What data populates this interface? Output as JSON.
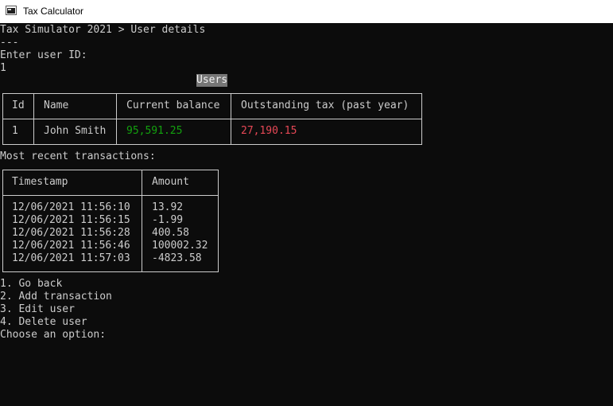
{
  "window": {
    "title": "Tax Calculator"
  },
  "breadcrumb": "Tax Simulator 2021 > User details",
  "separator": "---",
  "prompt_user_id": "Enter user ID:",
  "input_user_id": "1",
  "users_table": {
    "title": "Users",
    "headers": [
      "Id",
      "Name",
      "Current balance",
      "Outstanding tax (past year)"
    ],
    "row": [
      "1",
      "John Smith",
      "95,591.25",
      "27,190.15"
    ]
  },
  "transactions_label": "Most recent transactions:",
  "transactions_table": {
    "headers": [
      "Timestamp",
      "Amount"
    ],
    "rows": [
      [
        "12/06/2021 11:56:10",
        "13.92"
      ],
      [
        "12/06/2021 11:56:15",
        "-1.99"
      ],
      [
        "12/06/2021 11:56:28",
        "400.58"
      ],
      [
        "12/06/2021 11:56:46",
        "100002.32"
      ],
      [
        "12/06/2021 11:57:03",
        "-4823.58"
      ]
    ]
  },
  "menu": [
    "1. Go back",
    "2. Add transaction",
    "3. Edit user",
    "4. Delete user"
  ],
  "choose_prompt": "Choose an option:",
  "colors": {
    "positive": "#13a10e",
    "negative": "#e74856",
    "background": "#0c0c0c",
    "text": "#cccccc"
  }
}
